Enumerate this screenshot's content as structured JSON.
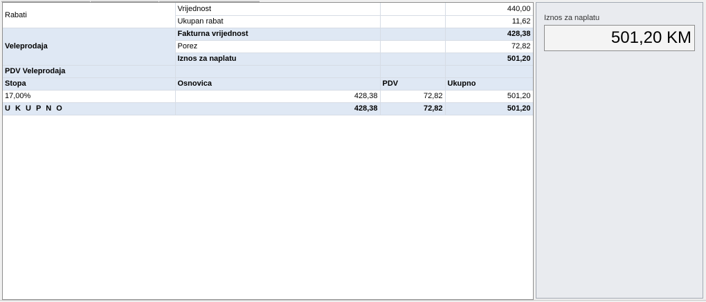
{
  "summary_grid": {
    "rabati": {
      "label": "Rabati",
      "rows": [
        {
          "label": "Vrijednost",
          "value": "440,00"
        },
        {
          "label": "Ukupan rabat",
          "value": "11,62"
        }
      ]
    },
    "veleprodaja": {
      "label": "Veleprodaja",
      "rows": [
        {
          "label": "Fakturna vrijednost",
          "value": "428,38"
        },
        {
          "label": "Porez",
          "value": "72,82"
        },
        {
          "label": "Iznos za naplatu",
          "value": "501,20"
        }
      ]
    },
    "pdv": {
      "section_title": "PDV Veleprodaja",
      "headers": [
        "Stopa",
        "Osnovica",
        "PDV",
        "Ukupno"
      ],
      "rows": [
        [
          "17,00%",
          "428,38",
          "72,82",
          "501,20"
        ]
      ],
      "total": [
        "U K U P N O",
        "428,38",
        "72,82",
        "501,20"
      ]
    }
  },
  "side_panel": {
    "label": "Iznos za naplatu",
    "amount": "501,20 KM"
  },
  "colors": {
    "highlight_row": "#dfe8f4",
    "grid_border": "#d6dce5",
    "panel_bg": "#e9ebef"
  }
}
